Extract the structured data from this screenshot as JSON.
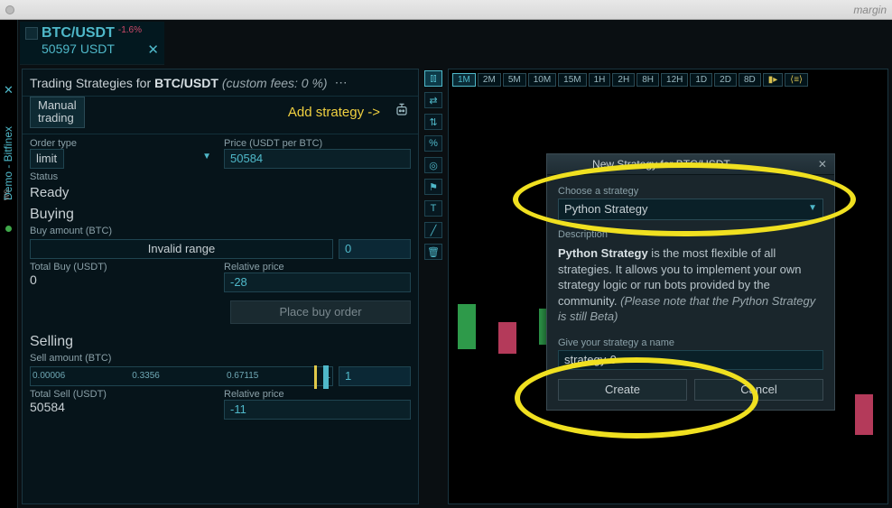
{
  "titlebar": {
    "title": "margin"
  },
  "sidebar": {
    "label": "Demo - Bitfinex",
    "ws": "ws"
  },
  "pair": {
    "symbol": "BTC/USDT",
    "change": "-1.6%",
    "price": "50597 USDT"
  },
  "strategies": {
    "prefix": "Trading Strategies for",
    "pair": "BTC/USDT",
    "fees": "(custom fees: 0 %)",
    "manual_tab": "Manual\ntrading",
    "add_hint": "Add strategy ->"
  },
  "form": {
    "order_type_label": "Order type",
    "order_type": "limit",
    "price_label": "Price (USDT per BTC)",
    "price": "50584",
    "status_label": "Status",
    "status": "Ready",
    "buying": "Buying",
    "buy_amount_label": "Buy amount (BTC)",
    "buy_range_text": "Invalid range",
    "buy_amount": "0",
    "total_buy_label": "Total Buy (USDT)",
    "total_buy": "0",
    "rel_price_label": "Relative price",
    "rel_buy": "-28",
    "place_buy": "Place buy order",
    "selling": "Selling",
    "sell_amount_label": "Sell amount (BTC)",
    "sell_ticks": [
      "0.00006",
      "0.3356",
      "0.67115",
      "1"
    ],
    "sell_amount": "1",
    "total_sell_label": "Total Sell (USDT)",
    "total_sell": "50584",
    "rel_sell": "-11"
  },
  "timeframes": [
    "1M",
    "2M",
    "5M",
    "10M",
    "15M",
    "1H",
    "2H",
    "8H",
    "12H",
    "1D",
    "2D",
    "8D"
  ],
  "dialog": {
    "title": "New Strategy for BTC/USDT ...",
    "choose_label": "Choose a strategy",
    "strategy": "Python Strategy",
    "desc_label": "Description",
    "desc_strong": "Python Strategy",
    "desc_rest": " is the most flexible of all strategies. It allows you to implement your own strategy logic or run bots provided by the community. ",
    "desc_note": "(Please note that the Python Strategy is still Beta)",
    "name_label": "Give your strategy a name",
    "name_value": "strategy-0",
    "create": "Create",
    "cancel": "Cancel"
  }
}
